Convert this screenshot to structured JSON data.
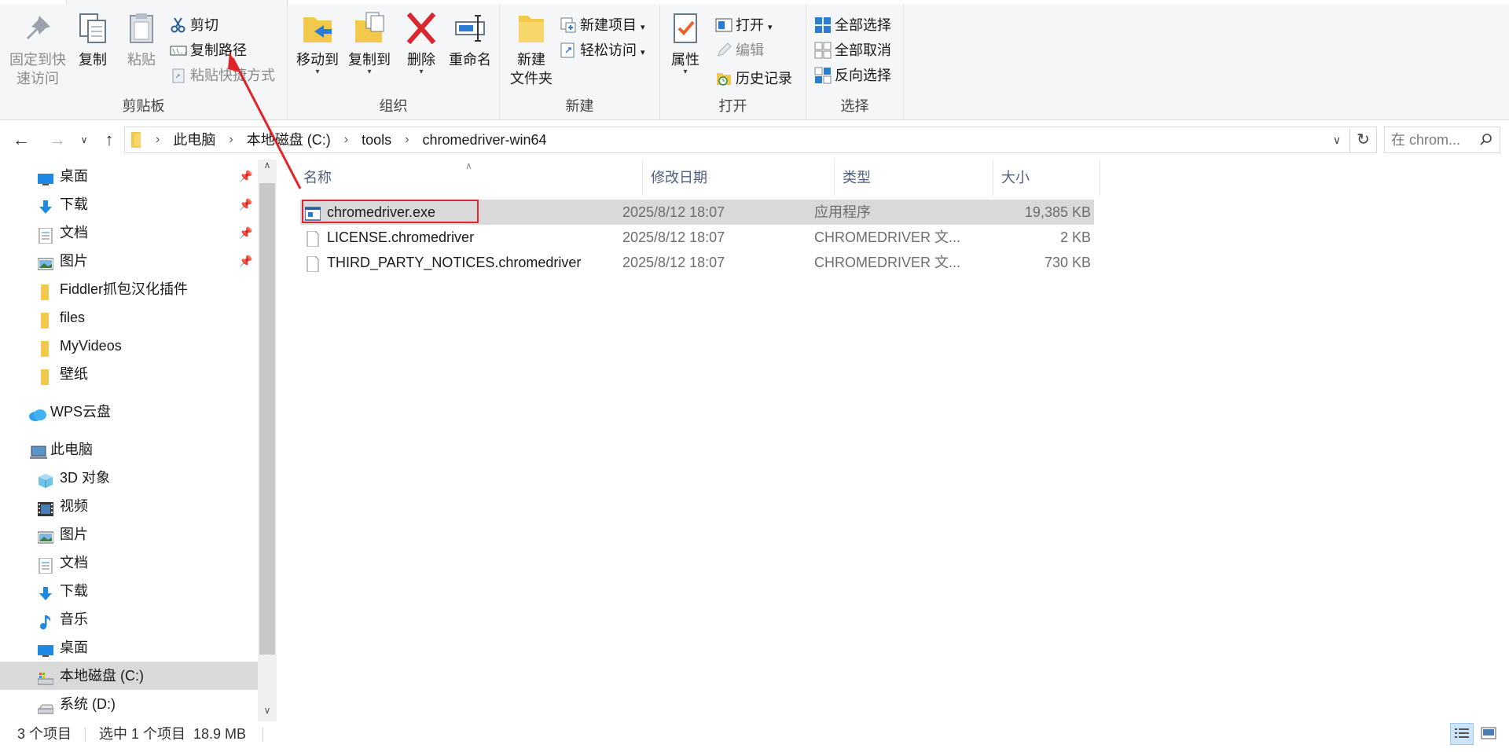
{
  "ribbon": {
    "clipboard": {
      "label": "剪贴板",
      "pin_label_line1": "固定到快",
      "pin_label_line2": "速访问",
      "copy_label": "复制",
      "paste_label": "粘贴",
      "cut_label": "剪切",
      "copy_path_label": "复制路径",
      "paste_shortcut_label": "粘贴快捷方式"
    },
    "organize": {
      "label": "组织",
      "move_to_label": "移动到",
      "copy_to_label": "复制到",
      "delete_label": "删除",
      "rename_label": "重命名"
    },
    "new": {
      "label": "新建",
      "new_folder_line1": "新建",
      "new_folder_line2": "文件夹",
      "new_item_label": "新建项目",
      "easy_access_label": "轻松访问"
    },
    "open": {
      "label": "打开",
      "properties_label": "属性",
      "open_label": "打开",
      "edit_label": "编辑",
      "history_label": "历史记录"
    },
    "select": {
      "label": "选择",
      "select_all_label": "全部选择",
      "select_none_label": "全部取消",
      "invert_label": "反向选择"
    }
  },
  "address": {
    "crumbs": [
      "此电脑",
      "本地磁盘 (C:)",
      "tools",
      "chromedriver-win64"
    ],
    "search_placeholder": "在 chrom..."
  },
  "sidebar": {
    "quick_access": [
      {
        "label": "桌面",
        "icon": "desktop-icon",
        "pinned": true
      },
      {
        "label": "下载",
        "icon": "download-icon",
        "pinned": true
      },
      {
        "label": "文档",
        "icon": "document-icon",
        "pinned": true
      },
      {
        "label": "图片",
        "icon": "pictures-icon",
        "pinned": true
      },
      {
        "label": "Fiddler抓包汉化插件",
        "icon": "folder-icon"
      },
      {
        "label": "files",
        "icon": "folder-icon"
      },
      {
        "label": "MyVideos",
        "icon": "folder-icon"
      },
      {
        "label": "壁纸",
        "icon": "folder-icon"
      }
    ],
    "wps": "WPS云盘",
    "this_pc": "此电脑",
    "pc_items": [
      {
        "label": "3D 对象",
        "icon": "3d-objects-icon"
      },
      {
        "label": "视频",
        "icon": "videos-icon"
      },
      {
        "label": "图片",
        "icon": "pictures-icon"
      },
      {
        "label": "文档",
        "icon": "document-icon"
      },
      {
        "label": "下载",
        "icon": "download-icon"
      },
      {
        "label": "音乐",
        "icon": "music-icon"
      },
      {
        "label": "桌面",
        "icon": "desktop-icon"
      },
      {
        "label": "本地磁盘 (C:)",
        "icon": "drive-icon",
        "selected": true
      },
      {
        "label": "系统 (D:)",
        "icon": "drive-icon"
      }
    ]
  },
  "list": {
    "columns": {
      "name": "名称",
      "date": "修改日期",
      "type": "类型",
      "size": "大小"
    },
    "rows": [
      {
        "name": "chromedriver.exe",
        "date": "2025/8/12 18:07",
        "type": "应用程序",
        "size": "19,385 KB",
        "icon": "exe-icon",
        "selected": true
      },
      {
        "name": "LICENSE.chromedriver",
        "date": "2025/8/12 18:07",
        "type": "CHROMEDRIVER 文...",
        "size": "2 KB",
        "icon": "file-icon"
      },
      {
        "name": "THIRD_PARTY_NOTICES.chromedriver",
        "date": "2025/8/12 18:07",
        "type": "CHROMEDRIVER 文...",
        "size": "730 KB",
        "icon": "file-icon"
      }
    ]
  },
  "status": {
    "count": "3 个项目",
    "selection": "选中 1 个项目  18.9 MB"
  },
  "colors": {
    "accent": "#0078d7",
    "annotation": "#e0242a",
    "selection": "#d9d9d9"
  }
}
